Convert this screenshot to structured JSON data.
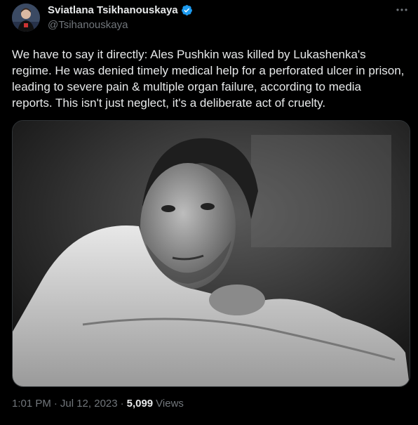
{
  "author": {
    "display_name": "Sviatlana Tsikhanouskaya",
    "handle": "@Tsihanouskaya",
    "verified": true,
    "avatar_icon": "profile-photo",
    "verified_color": "#1d9bf0"
  },
  "more_icon": "more-horizontal-icon",
  "tweet": {
    "text": "We have to say it directly: Ales Pushkin was killed by Lukashenka's regime. He was denied timely medical help for a perforated ulcer in prison, leading to severe pain & multiple organ failure, according to media reports. This isn't just neglect, it's a deliberate act of cruelty."
  },
  "media": {
    "kind": "black-and-white photo",
    "description_icon": "photo-image"
  },
  "meta": {
    "time": "1:01 PM",
    "separator": "·",
    "date": "Jul 12, 2023",
    "separator2": "·",
    "views_count": "5,099",
    "views_label": "Views"
  },
  "colors": {
    "background": "#000000",
    "text": "#e7e9ea",
    "secondary": "#71767b",
    "accent": "#1d9bf0"
  }
}
